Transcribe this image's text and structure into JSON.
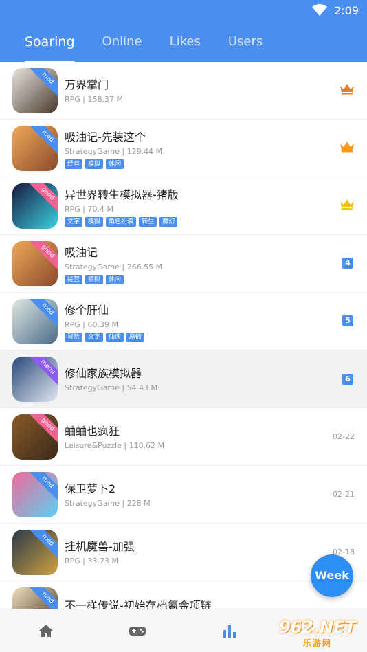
{
  "status": {
    "time": "2:09"
  },
  "tabs": [
    {
      "label": "Soaring",
      "active": true
    },
    {
      "label": "Online",
      "active": false
    },
    {
      "label": "Likes",
      "active": false
    },
    {
      "label": "Users",
      "active": false
    }
  ],
  "apps": [
    {
      "name": "万界掌门",
      "meta": "RPG | 158.37 M",
      "tags": [],
      "badge": "mod",
      "rank": {
        "type": "crown",
        "color": "#f07a1a"
      },
      "colors": [
        "#e8e4dc",
        "#4a3a30"
      ]
    },
    {
      "name": "吸油记-先装这个",
      "meta": "StrategyGame | 129.44 M",
      "tags": [
        "经营",
        "模拟",
        "休闲"
      ],
      "badge": "mod",
      "rank": {
        "type": "crown",
        "color": "#f59a1a"
      },
      "colors": [
        "#f0a85a",
        "#8a4a2a"
      ]
    },
    {
      "name": "异世界转生模拟器-猪版",
      "meta": "RPG | 70.4 M",
      "tags": [
        "文字",
        "模拟",
        "角色扮演",
        "转生",
        "魔幻"
      ],
      "badge": "good",
      "rank": {
        "type": "crown",
        "color": "#f5c21a"
      },
      "colors": [
        "#1a1a40",
        "#3ad0e0"
      ]
    },
    {
      "name": "吸油记",
      "meta": "StrategyGame | 266.55 M",
      "tags": [
        "经营",
        "模拟",
        "休闲"
      ],
      "badge": "good",
      "rank": {
        "type": "number",
        "value": "4"
      },
      "colors": [
        "#f0a85a",
        "#8a4a2a"
      ]
    },
    {
      "name": "修个肝仙",
      "meta": "RPG | 60.39 M",
      "tags": [
        "冒险",
        "文字",
        "仙侠",
        "剧情"
      ],
      "badge": "mod",
      "rank": {
        "type": "number",
        "value": "5"
      },
      "colors": [
        "#dfe8e0",
        "#4a6a8a"
      ]
    },
    {
      "name": "修仙家族模拟器",
      "meta": "StrategyGame | 54.43 M",
      "tags": [],
      "badge": "menu",
      "rank": {
        "type": "number",
        "value": "6"
      },
      "colors": [
        "#2a4a7a",
        "#e0e6f0"
      ],
      "highlight": true
    },
    {
      "name": "蛐蛐也疯狂",
      "meta": "Leisure&Puzzle | 110.62 M",
      "tags": [],
      "badge": "good",
      "rank": {
        "type": "date",
        "value": "02-22"
      },
      "colors": [
        "#8a5a2a",
        "#3a2a1a"
      ]
    },
    {
      "name": "保卫萝卜2",
      "meta": "StrategyGame | 228 M",
      "tags": [],
      "badge": "mod",
      "rank": {
        "type": "date",
        "value": "02-21"
      },
      "colors": [
        "#f06a9a",
        "#5ad0f0"
      ]
    },
    {
      "name": "挂机魔兽-加强",
      "meta": "RPG | 33.73 M",
      "tags": [],
      "badge": "mod",
      "rank": {
        "type": "date",
        "value": "02-18"
      },
      "colors": [
        "#2a3a4a",
        "#d0a040"
      ]
    },
    {
      "name": "不一样传说-初始存档氪金项链",
      "meta": "",
      "tags": [],
      "badge": "mod",
      "rank": {
        "type": "none"
      },
      "colors": [
        "#f0e0c0",
        "#3a2a1a"
      ]
    }
  ],
  "fab_label": "Week",
  "watermark": {
    "top": "962.NET",
    "bottom": "乐游网"
  },
  "nav": [
    "home-icon",
    "gamepad-icon",
    "ranking-icon"
  ],
  "accent": "#4a8ef0"
}
